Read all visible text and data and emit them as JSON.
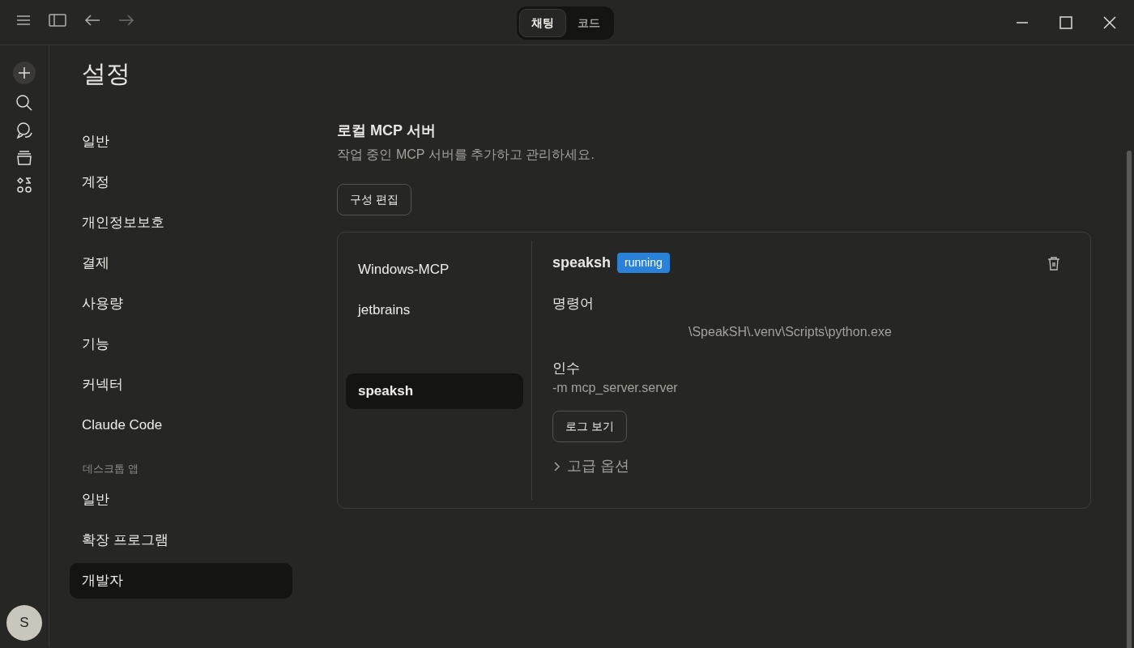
{
  "titlebar": {
    "modes": [
      {
        "label": "채팅",
        "selected": true
      },
      {
        "label": "코드",
        "selected": false
      }
    ]
  },
  "rail": {
    "avatar": "S"
  },
  "settings": {
    "title": "설정",
    "nav": [
      {
        "label": "일반",
        "selected": false
      },
      {
        "label": "계정",
        "selected": false
      },
      {
        "label": "개인정보보호",
        "selected": false
      },
      {
        "label": "결제",
        "selected": false
      },
      {
        "label": "사용량",
        "selected": false
      },
      {
        "label": "기능",
        "selected": false
      },
      {
        "label": "커넥터",
        "selected": false
      },
      {
        "label": "Claude Code",
        "selected": false
      }
    ],
    "section_label": "데스크톱 앱",
    "app_nav": [
      {
        "label": "일반",
        "selected": false
      },
      {
        "label": "확장 프로그램",
        "selected": false
      },
      {
        "label": "개발자",
        "selected": true
      }
    ]
  },
  "content": {
    "heading": "로컬 MCP 서버",
    "subtitle": "작업 중인 MCP 서버를 추가하고 관리하세요.",
    "edit_button": "구성 편집",
    "servers": [
      {
        "name": "Windows-MCP",
        "selected": false
      },
      {
        "name": "jetbrains",
        "selected": false
      },
      {
        "name": "speaksh",
        "selected": true
      }
    ],
    "detail": {
      "name": "speaksh",
      "status": "running",
      "command_label": "명령어",
      "command": "\\SpeakSH\\.venv\\Scripts\\python.exe",
      "args_label": "인수",
      "args": "-m mcp_server.server",
      "log_button": "로그 보기",
      "advanced": "고급 옵션",
      "advanced_expanded": false
    }
  }
}
